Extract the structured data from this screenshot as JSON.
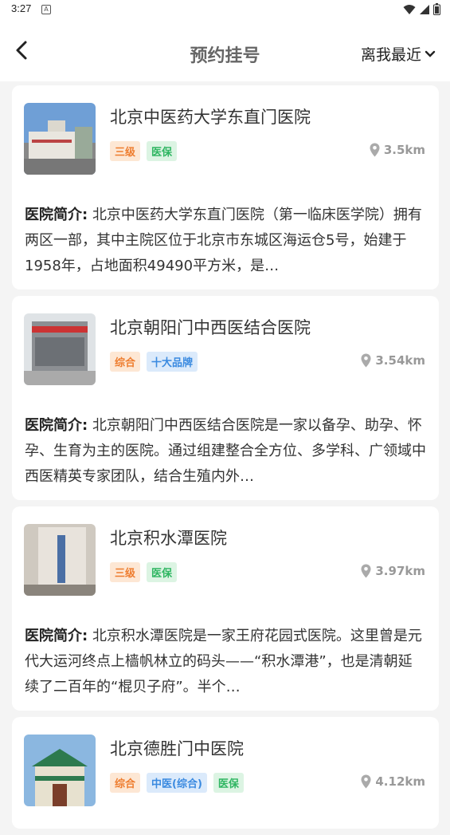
{
  "status": {
    "time": "3:27",
    "notif": "A"
  },
  "header": {
    "title": "预约挂号",
    "sort_label": "离我最近"
  },
  "intro_label": "医院简介:",
  "hospitals": [
    {
      "name": "北京中医药大学东直门医院",
      "tags": [
        {
          "text": "三级",
          "style": "orange"
        },
        {
          "text": "医保",
          "style": "green"
        }
      ],
      "distance": "3.5km",
      "intro": "北京中医药大学东直门医院（第一临床医学院）拥有两区一部，其中主院区位于北京市东城区海运仓5号，始建于1958年，占地面积49490平方米，是…"
    },
    {
      "name": "北京朝阳门中西医结合医院",
      "tags": [
        {
          "text": "综合",
          "style": "orange"
        },
        {
          "text": "十大品牌",
          "style": "blue"
        }
      ],
      "distance": "3.54km",
      "intro": "北京朝阳门中西医结合医院是一家以备孕、助孕、怀孕、生育为主的医院。通过组建整合全方位、多学科、广领域中西医精英专家团队，结合生殖内外…"
    },
    {
      "name": "北京积水潭医院",
      "tags": [
        {
          "text": "三级",
          "style": "orange"
        },
        {
          "text": "医保",
          "style": "green"
        }
      ],
      "distance": "3.97km",
      "intro": "北京积水潭医院是一家王府花园式医院。这里曾是元代大运河终点上樯帆林立的码头——“积水潭港”，也是清朝延续了二百年的“棍贝子府”。半个…"
    },
    {
      "name": "北京德胜门中医院",
      "tags": [
        {
          "text": "综合",
          "style": "orange"
        },
        {
          "text": "中医(综合)",
          "style": "blue"
        },
        {
          "text": "医保",
          "style": "green"
        }
      ],
      "distance": "4.12km",
      "intro": ""
    }
  ]
}
